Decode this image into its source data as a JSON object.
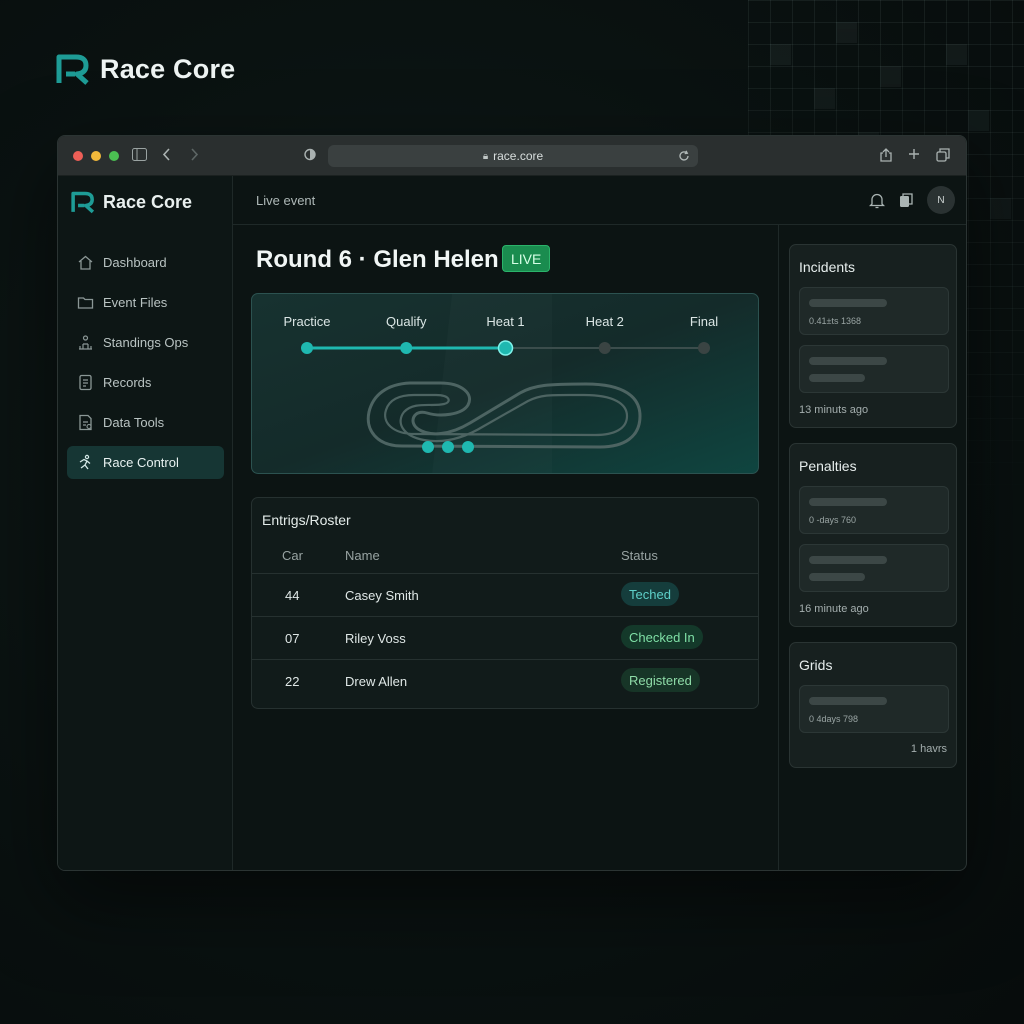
{
  "brand": {
    "name": "Race Core"
  },
  "browser": {
    "url": "race.core"
  },
  "sidebar": {
    "brand": "Race Core",
    "items": [
      {
        "label": "Dashboard",
        "icon": "home-icon",
        "active": false
      },
      {
        "label": "Event Files",
        "icon": "folder-icon",
        "active": false
      },
      {
        "label": "Standings Ops",
        "icon": "standings-icon",
        "active": false
      },
      {
        "label": "Records",
        "icon": "document-icon",
        "active": false
      },
      {
        "label": "Data Tools",
        "icon": "data-tools-icon",
        "active": false
      },
      {
        "label": "Race Control",
        "icon": "race-control-icon",
        "active": true
      }
    ]
  },
  "header": {
    "section": "Live event",
    "avatar_initials": "N"
  },
  "event": {
    "title": "Round 6 · Glen Helen",
    "badge": "LIVE",
    "stages": [
      {
        "label": "Practice",
        "done": true
      },
      {
        "label": "Qualify",
        "done": true
      },
      {
        "label": "Heat 1",
        "done": true,
        "current": true
      },
      {
        "label": "Heat 2",
        "done": false
      },
      {
        "label": "Final",
        "done": false
      }
    ]
  },
  "roster": {
    "title": "Entrigs/Roster",
    "columns": {
      "car": "Car",
      "name": "Name",
      "status": "Status"
    },
    "rows": [
      {
        "car": "44",
        "name": "Casey Smith",
        "status": "Teched",
        "color": "#5fd0c9",
        "bg": "#153d3c"
      },
      {
        "car": "07",
        "name": "Riley Voss",
        "status": "Checked In",
        "color": "#7fe0a6",
        "bg": "#14392a"
      },
      {
        "car": "22",
        "name": "Drew Allen",
        "status": "Registered",
        "color": "#8fdca8",
        "bg": "#173527"
      }
    ]
  },
  "panels": {
    "incidents": {
      "title": "Incidents",
      "item1_sub": "0.41±ts 1368",
      "time": "13 minuts ago"
    },
    "penalties": {
      "title": "Penalties",
      "item1_sub": "0 -days 760",
      "time": "16 minute ago"
    },
    "grids": {
      "title": "Grids",
      "item1_sub": "0 4days 798",
      "time": "1 havrs"
    }
  },
  "colors": {
    "accent": "#1fb8b0",
    "live": "#1a8c4f",
    "background": "#0a1211"
  }
}
